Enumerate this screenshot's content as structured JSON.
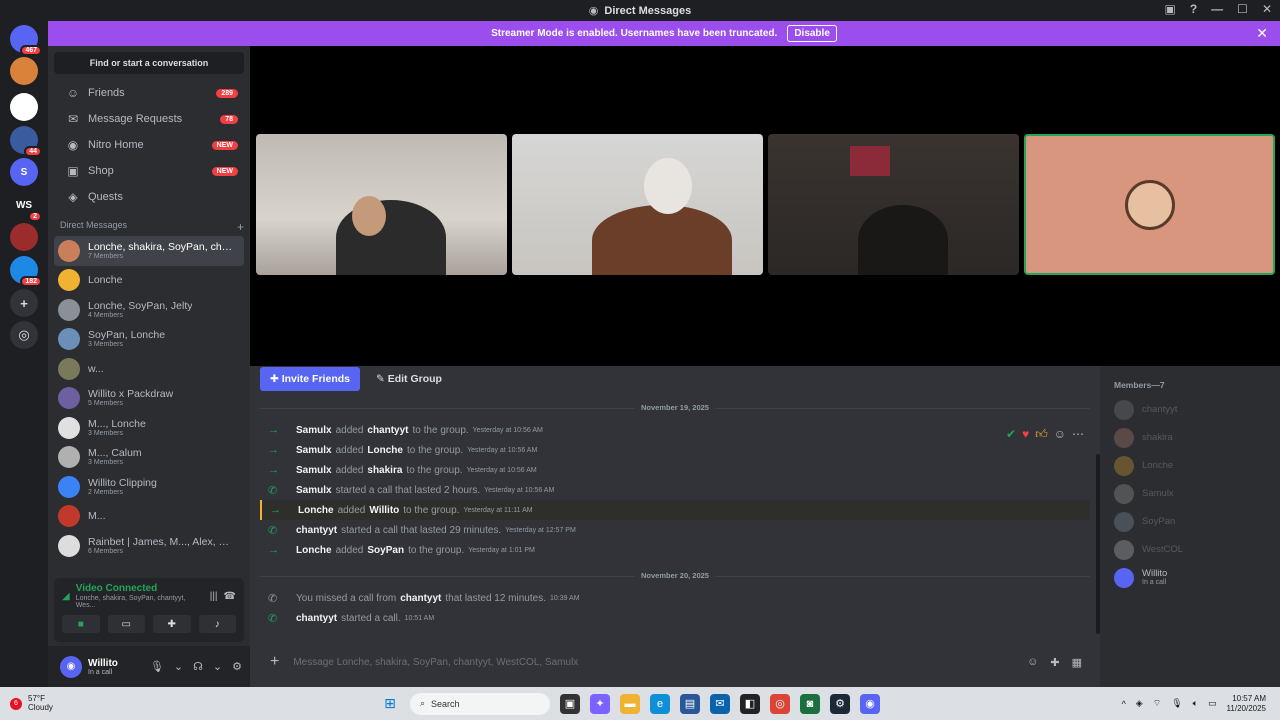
{
  "window": {
    "title": "Direct Messages"
  },
  "banner": {
    "text": "Streamer Mode is enabled. Usernames have been truncated.",
    "button": "Disable"
  },
  "servers": [
    {
      "label": "",
      "badge": "467",
      "color": "#5865f2"
    },
    {
      "label": "",
      "badge": "",
      "color": "#d9823b"
    },
    {
      "label": "",
      "badge": "",
      "color": "#ffffff"
    },
    {
      "label": "",
      "badge": "44",
      "color": "#3a5ba0"
    },
    {
      "label": "S",
      "badge": "",
      "color": "#5865f2"
    },
    {
      "label": "WS",
      "badge": "2",
      "color": "#1e1f22"
    },
    {
      "label": "",
      "badge": "",
      "color": "#9b2c2c"
    },
    {
      "label": "",
      "badge": "182",
      "color": "#1e88e5"
    }
  ],
  "sidebar": {
    "find_placeholder": "Find or start a conversation",
    "nav": [
      {
        "label": "Friends",
        "pill": "289",
        "icon": "friends-icon"
      },
      {
        "label": "Message Requests",
        "pill": "78",
        "icon": "mail-icon"
      },
      {
        "label": "Nitro Home",
        "pill": "NEW",
        "icon": "nitro-icon"
      },
      {
        "label": "Shop",
        "pill": "NEW",
        "icon": "shop-icon"
      },
      {
        "label": "Quests",
        "pill": "",
        "icon": "quests-icon"
      }
    ],
    "dm_header": "Direct Messages",
    "dms": [
      {
        "name": "Lonche, shakira, SoyPan, cha...",
        "sub": "7 Members",
        "active": true,
        "color": "#c9805a"
      },
      {
        "name": "Lonche",
        "sub": "",
        "color": "#f0b232"
      },
      {
        "name": "Lonche, SoyPan, Jelty",
        "sub": "4 Members",
        "color": "#8a8f98"
      },
      {
        "name": "SoyPan, Lonche",
        "sub": "3 Members",
        "color": "#6b8fb8"
      },
      {
        "name": "w...",
        "sub": "",
        "color": "#7a7a5a"
      },
      {
        "name": "Willito x Packdraw",
        "sub": "5 Members",
        "color": "#6d5fa0"
      },
      {
        "name": "M..., Lonche",
        "sub": "3 Members",
        "color": "#e0e0e0"
      },
      {
        "name": "M..., Calum",
        "sub": "3 Members",
        "color": "#b0b0b0"
      },
      {
        "name": "Willito Clipping",
        "sub": "2 Members",
        "color": "#3b82f6"
      },
      {
        "name": "M...",
        "sub": "",
        "color": "#c0392b"
      },
      {
        "name": "Rainbet | James, M..., Alex, Lo...",
        "sub": "6 Members",
        "color": "#dddddd"
      }
    ],
    "voice": {
      "status": "Video Connected",
      "channel": "Lonche, shakira, SoyPan, chantyyt, Wes..."
    },
    "user": {
      "name": "Willito",
      "status": "In a call"
    }
  },
  "call": {
    "actions": {
      "invite": "Invite Friends",
      "edit": "Edit Group"
    }
  },
  "chat": {
    "dates": [
      "November 19, 2025",
      "November 20, 2025"
    ],
    "messages": [
      {
        "type": "join",
        "user": "Samulx",
        "text": "added",
        "target": "chantyyt",
        "after": "to the group.",
        "ts": "Yesterday at 10:56 AM"
      },
      {
        "type": "join",
        "user": "Samulx",
        "text": "added",
        "target": "Lonche",
        "after": "to the group.",
        "ts": "Yesterday at 10:56 AM"
      },
      {
        "type": "join",
        "user": "Samulx",
        "text": "added",
        "target": "shakira",
        "after": "to the group.",
        "ts": "Yesterday at 10:56 AM"
      },
      {
        "type": "call",
        "user": "Samulx",
        "text": "started a call that lasted 2 hours.",
        "target": "",
        "after": "",
        "ts": "Yesterday at 10:56 AM"
      },
      {
        "type": "join",
        "user": "Lonche",
        "text": "added",
        "target": "Willito",
        "after": "to the group.",
        "ts": "Yesterday at 11:11 AM",
        "hl": true
      },
      {
        "type": "call",
        "user": "chantyyt",
        "text": "started a call that lasted 29 minutes.",
        "target": "",
        "after": "",
        "ts": "Yesterday at 12:57 PM"
      },
      {
        "type": "join",
        "user": "Lonche",
        "text": "added",
        "target": "SoyPan",
        "after": "to the group.",
        "ts": "Yesterday at 1:01 PM"
      }
    ],
    "messages2": [
      {
        "type": "miss",
        "user": "",
        "text": "You missed a call from",
        "target": "chantyyt",
        "after": "that lasted 12 minutes.",
        "ts": "10:39 AM"
      },
      {
        "type": "call",
        "user": "chantyyt",
        "text": "started a call.",
        "target": "",
        "after": "",
        "ts": "10:51 AM"
      }
    ],
    "composer_placeholder": "Message Lonche, shakira, SoyPan, chantyyt, WestCOL, Samulx"
  },
  "members": {
    "header": "Members—7",
    "list": [
      {
        "name": "chantyyt",
        "status": "",
        "color": "#888888",
        "on": false
      },
      {
        "name": "shakira",
        "status": "",
        "color": "#c98a7a",
        "on": false
      },
      {
        "name": "Lonche",
        "status": "",
        "color": "#f0b232",
        "on": false
      },
      {
        "name": "Samulx",
        "status": "",
        "color": "#aaaaaa",
        "on": false
      },
      {
        "name": "SoyPan",
        "status": "",
        "color": "#8ea0b0",
        "on": false
      },
      {
        "name": "WestCOL",
        "status": "",
        "color": "#cccccc",
        "on": false
      },
      {
        "name": "Willito",
        "status": "In a call",
        "color": "#5865f2",
        "on": true
      }
    ]
  },
  "taskbar": {
    "weather_temp": "57°F",
    "weather_desc": "Cloudy",
    "weather_badge": "6",
    "search": "Search",
    "time": "10:57 AM",
    "date": "11/20/2025"
  }
}
